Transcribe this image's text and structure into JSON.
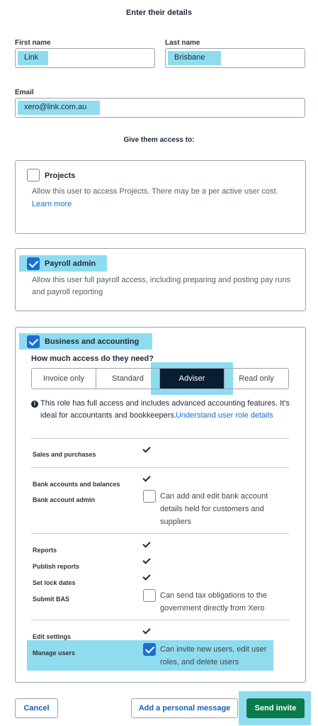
{
  "header": {
    "title": "Enter their details"
  },
  "form": {
    "first_name_label": "First name",
    "first_name_value": "Link",
    "last_name_label": "Last name",
    "last_name_value": "Brisbane",
    "email_label": "Email",
    "email_value": "xero@link.com.au"
  },
  "access": {
    "heading": "Give them access to:",
    "projects": {
      "title": "Projects",
      "checked": false,
      "desc": "Allow this user to access Projects. There may be a per active user cost.",
      "link": "Learn more"
    },
    "payroll": {
      "title": "Payroll admin",
      "checked": true,
      "desc1": "Allow this user full payroll access, including preparing and posting pay runs",
      "desc2": "and payroll reporting"
    },
    "business": {
      "title": "Business and accounting",
      "checked": true,
      "question": "How much access do they need?",
      "options": [
        "Invoice only",
        "Standard",
        "Adviser",
        "Read only"
      ],
      "selected": "Adviser",
      "info_line1": "This role has full access and includes advanced accounting features. It's",
      "info_line2": "ideal for accountants and bookkeepers.",
      "info_link": "Understand user role details",
      "permissions": {
        "sales": "Sales and purchases",
        "bank_accounts": "Bank accounts and balances",
        "bank_admin": "Bank account admin",
        "bank_admin_desc1": "Can add and edit bank account",
        "bank_admin_desc2": "details held for customers and",
        "bank_admin_desc3": "suppliers",
        "reports": "Reports",
        "publish_reports": "Publish reports",
        "set_lock_dates": "Set lock dates",
        "submit_bas": "Submit BAS",
        "submit_bas_desc1": "Can send tax obligations to the",
        "submit_bas_desc2": "government directly from Xero",
        "edit_settings": "Edit settings",
        "manage_users": "Manage users",
        "manage_users_desc1": "Can invite new users, edit user",
        "manage_users_desc2": "roles, and delete users"
      }
    }
  },
  "footer": {
    "cancel": "Cancel",
    "add_message": "Add a personal message",
    "send_invite": "Send invite"
  },
  "colors": {
    "accent": "#1b6ed1",
    "highlight": "#8fdcf0",
    "send_button": "#0b7a4b",
    "selected_segment": "#0a1e33"
  }
}
